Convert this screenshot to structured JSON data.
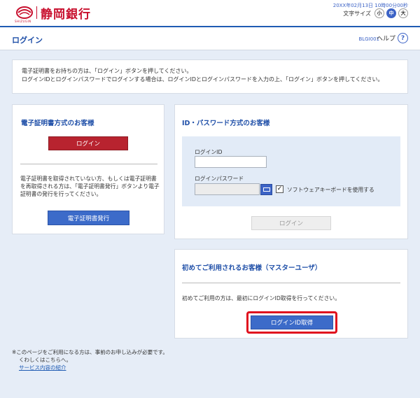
{
  "header": {
    "bank_name": "静岡銀行",
    "logo_subtext": "SHIZUGIN",
    "datetime": "20XX年02月13日 10時00分00秒",
    "font_size_label": "文字サイズ",
    "font_sizes": [
      "小",
      "中",
      "大"
    ],
    "active_font_size": "中",
    "brand_color": "#c8102e"
  },
  "titlebar": {
    "title": "ログイン",
    "screen_id": "BLGI001",
    "help_label": "ヘルプ",
    "help_icon": "?"
  },
  "notice": {
    "line1": "電子証明書をお持ちの方は、「ログイン」ボタンを押してください。",
    "line2": "ログインIDとログインパスワードでログインする場合は、ログインIDとログインパスワードを入力の上、「ログイン」ボタンを押してください。"
  },
  "cert_panel": {
    "title": "電子証明書方式のお客様",
    "login_button": "ログイン",
    "description": "電子証明書を取得されていない方、もしくは電子証明書を再取得される方は、「電子証明書発行」ボタンより電子証明書の発行を行ってください。",
    "issue_button": "電子証明書発行"
  },
  "id_panel": {
    "title": "ID・パスワード方式のお客様",
    "login_id_label": "ログインID",
    "login_id_value": "",
    "password_label": "ログインパスワード",
    "password_value": "",
    "software_keyboard_label": "ソフトウェアキーボードを使用する",
    "software_keyboard_checked": "✓",
    "login_button": "ログイン"
  },
  "master_panel": {
    "title": "初めてご利用されるお客様（マスターユーザ）",
    "description": "初めてご利用の方は、最初にログインID取得を行ってください。",
    "button": "ログインID取得"
  },
  "footer": {
    "note1": "※このページをご利用になる方は、事前のお申し込みが必要です。",
    "note2": "くわしくはこちらへ。",
    "link": "サービス内容の紹介"
  }
}
